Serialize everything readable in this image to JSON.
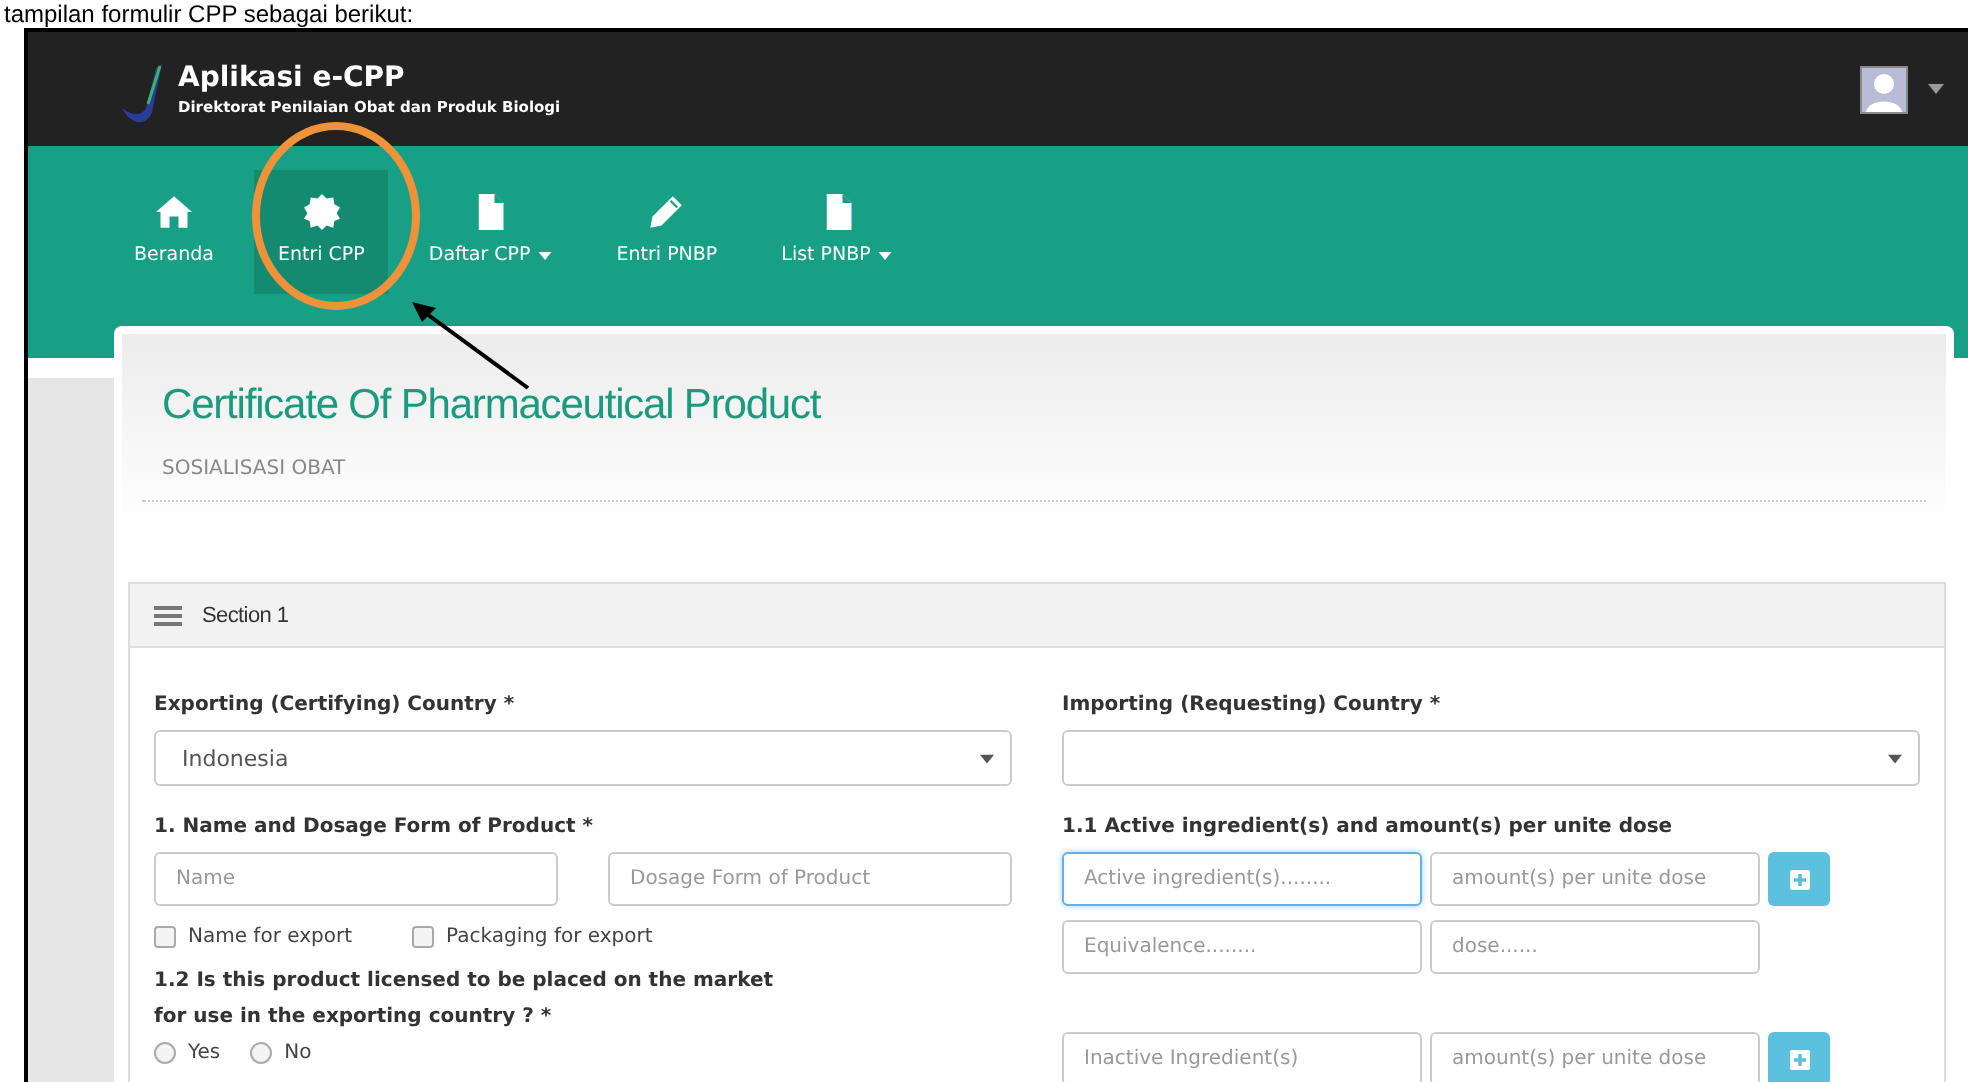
{
  "caption": "tampilan formulir CPP sebagai berikut:",
  "app": {
    "title": "Aplikasi e-CPP",
    "subtitle": "Direktorat Penilaian Obat dan Produk Biologi"
  },
  "nav": [
    {
      "label": "Beranda",
      "selected": false,
      "dropdown": false
    },
    {
      "label": "Entri CPP",
      "selected": true,
      "dropdown": false
    },
    {
      "label": "Daftar CPP",
      "selected": false,
      "dropdown": true
    },
    {
      "label": "Entri PNBP",
      "selected": false,
      "dropdown": false
    },
    {
      "label": "List PNBP",
      "selected": false,
      "dropdown": true
    }
  ],
  "page": {
    "title": "Certificate Of Pharmaceutical Product",
    "subtitle": "SOSIALISASI OBAT"
  },
  "section": {
    "title": "Section 1",
    "left": [
      {
        "kind": "label",
        "text": "Exporting (Certifying) Country *"
      },
      {
        "kind": "select",
        "value": "Indonesia"
      },
      {
        "kind": "label",
        "text": "1. Name and Dosage Form of Product *"
      },
      {
        "kind": "inputs",
        "add": false,
        "fields": [
          {
            "placeholder": "Name",
            "focused": false
          },
          {
            "placeholder": "Dosage Form of Product",
            "focused": false
          }
        ]
      },
      {
        "kind": "checkboxes",
        "options": [
          {
            "label": "Name for export",
            "checked": false
          },
          {
            "label": "Packaging for export",
            "checked": false
          }
        ]
      },
      {
        "kind": "label",
        "text": "1.2 Is this product licensed to be placed on the market\nfor use in the exporting country ? *"
      },
      {
        "kind": "radios",
        "options": [
          {
            "label": "Yes",
            "selected": false
          },
          {
            "label": "No",
            "selected": false
          }
        ]
      }
    ],
    "right": [
      {
        "kind": "label",
        "text": "Importing (Requesting) Country *"
      },
      {
        "kind": "select"
      },
      {
        "kind": "label",
        "text": "1.1 Active ingredient(s) and amount(s) per unite dose"
      },
      {
        "kind": "ingredients",
        "add": true,
        "fields": [
          {
            "placeholder": "Active ingredient(s)........",
            "focused": true
          },
          {
            "placeholder": "amount(s) per unite dose",
            "focused": false
          }
        ]
      },
      {
        "kind": "ingredients",
        "add": false,
        "fields": [
          {
            "placeholder": "Equivalence........",
            "focused": false
          },
          {
            "placeholder": "dose......",
            "focused": false
          }
        ]
      },
      {
        "kind": "spacer"
      },
      {
        "kind": "ingredients",
        "add": true,
        "fields": [
          {
            "placeholder": "Inactive Ingredient(s)",
            "focused": false
          },
          {
            "placeholder": "amount(s) per unite dose",
            "focused": false
          }
        ]
      }
    ]
  }
}
